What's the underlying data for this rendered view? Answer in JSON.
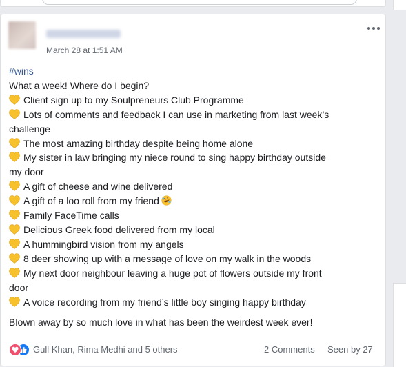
{
  "post": {
    "timestamp": "March 28 at 1:51 AM",
    "hashtag": "#wins",
    "intro": "What a week! Where do I begin?",
    "items": [
      "Client sign up to my Soulpreneurs Club Programme",
      "Lots of comments and feedback I can use in marketing from last week’s",
      "challenge",
      "The most amazing birthday despite being home alone",
      "My sister in law bringing my niece round to sing happy birthday outside",
      "my door",
      "A gift of cheese and wine delivered",
      "A gift of a loo roll from my friend",
      "Family FaceTime calls",
      "Delicious Greek food delivered from my local",
      "A hummingbird vision from my angels",
      "8 deer showing up with a message of love on my walk in the woods",
      "My next door neighbour leaving a huge pot of flowers outside my front",
      "door",
      "A voice recording from my friend’s little boy singing happy birthday"
    ],
    "closing": "Blown away by so much love in what has been the weirdest week ever!"
  },
  "footer": {
    "reactors": "Gull Khan, Rima Medhi and 5 others",
    "comments": "2 Comments",
    "seen": "Seen by 27"
  },
  "colors": {
    "accent": "#385898",
    "heart": "#f7c12d",
    "love": "#f0506e",
    "like": "#1877f2"
  },
  "icons": {
    "bullet": "yellow-heart-icon",
    "laugh": "rolling-laughing-emoji-icon",
    "more": "more-options-icon"
  }
}
